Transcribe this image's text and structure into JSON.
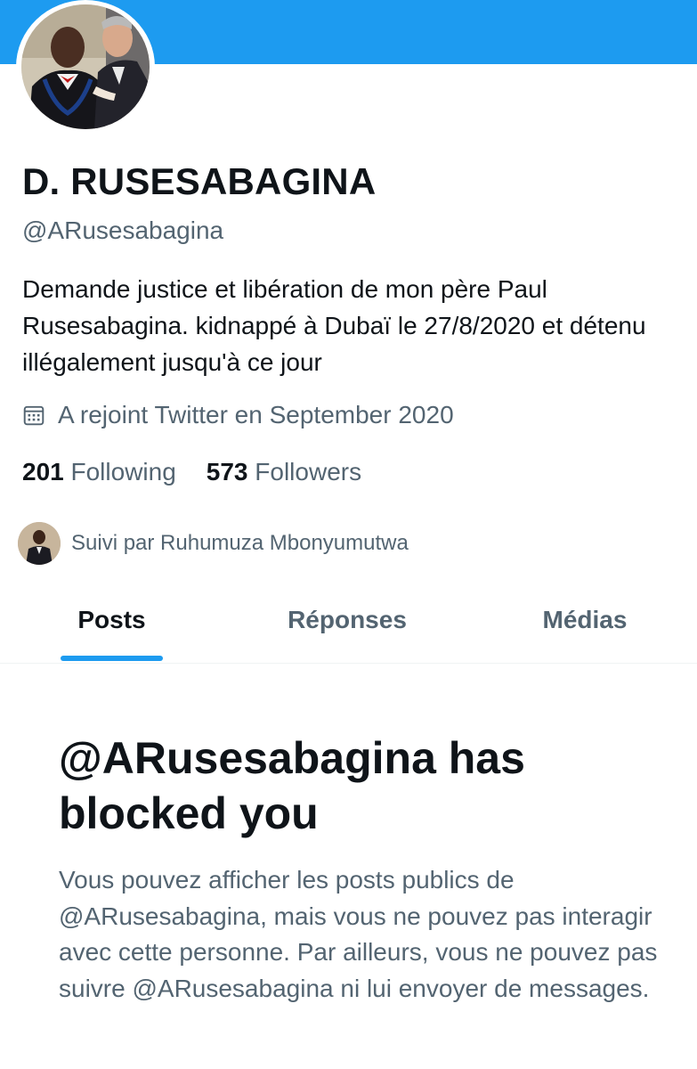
{
  "profile": {
    "display_name": "D. RUSESABAGINA",
    "handle": "@ARusesabagina",
    "bio": "Demande justice et libération de mon père Paul Rusesabagina. kidnappé à Dubaï le 27/8/2020 et détenu illégalement jusqu'à ce jour",
    "joined": "A rejoint Twitter en September 2020",
    "joined_icon": "calendar-icon",
    "stats": {
      "following_count": "201",
      "following_label": "Following",
      "followers_count": "573",
      "followers_label": "Followers"
    },
    "followed_by": "Suivi par Ruhumuza Mbonyumutwa"
  },
  "tabs": [
    {
      "label": "Posts",
      "active": true
    },
    {
      "label": "Réponses",
      "active": false
    },
    {
      "label": "Médias",
      "active": false
    }
  ],
  "blocked": {
    "title": "@ARusesabagina has blocked you",
    "message": "Vous pouvez afficher les posts publics de @ARusesabagina, mais vous ne pouvez pas interagir avec cette personne. Par ailleurs, vous ne pouvez pas suivre @ARusesabagina ni lui envoyer de messages."
  },
  "colors": {
    "banner": "#1d9bf0",
    "accent": "#1d9bf0",
    "primary_text": "#0f1419",
    "secondary_text": "#536471"
  }
}
